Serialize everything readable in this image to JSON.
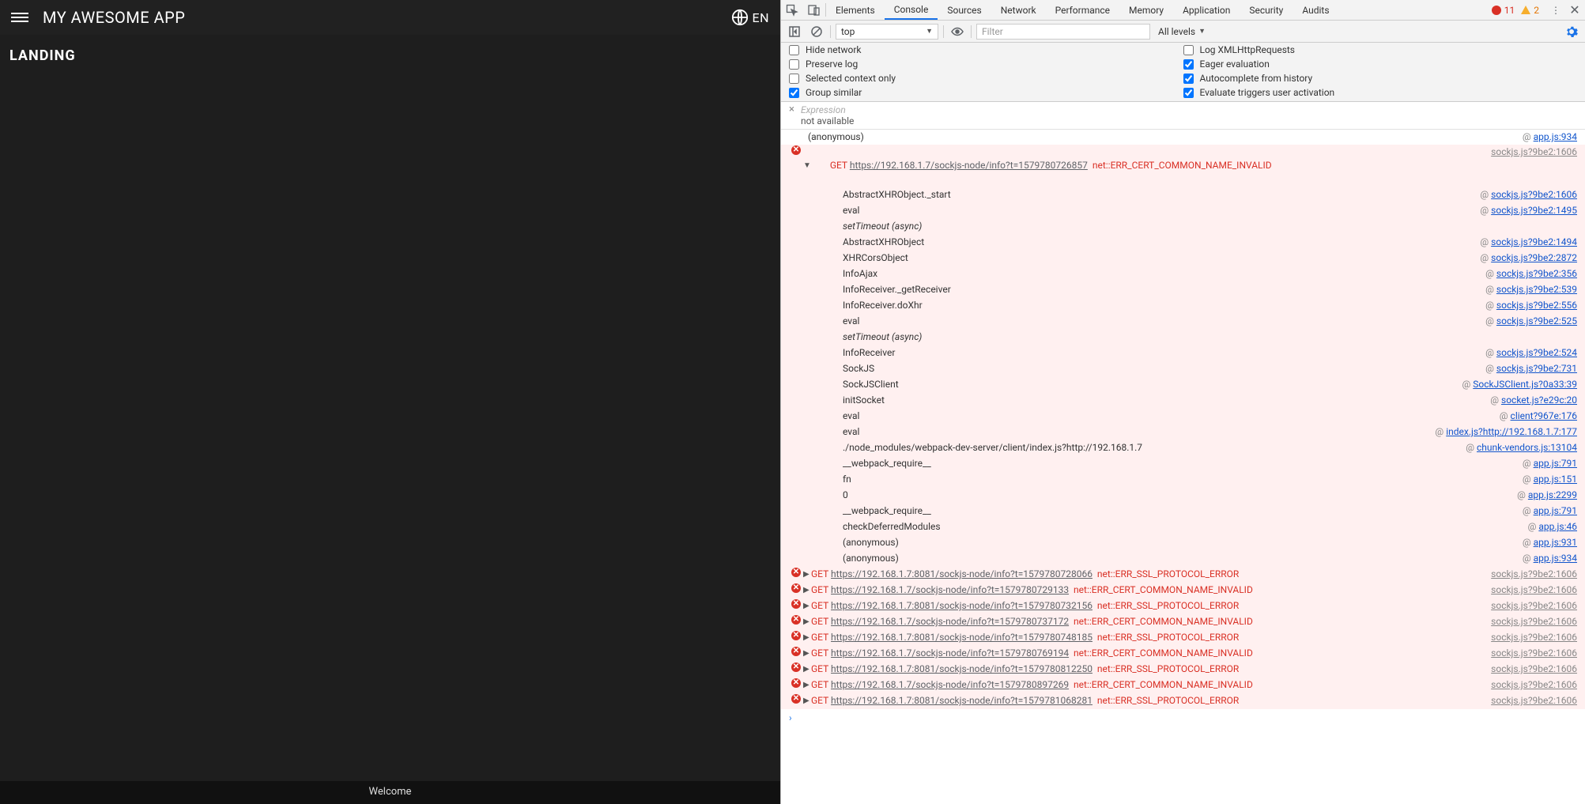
{
  "app": {
    "title": "MY AWESOME APP",
    "lang": "EN",
    "heading": "LANDING",
    "footer": "Welcome"
  },
  "devtools": {
    "tabs": [
      "Elements",
      "Console",
      "Sources",
      "Network",
      "Performance",
      "Memory",
      "Application",
      "Security",
      "Audits"
    ],
    "active_tab_index": 1,
    "error_count": "11",
    "warning_count": "2",
    "toolbar": {
      "context": "top",
      "filter_placeholder": "Filter",
      "levels_label": "All levels"
    },
    "options": [
      {
        "label": "Hide network",
        "checked": false
      },
      {
        "label": "Log XMLHttpRequests",
        "checked": false
      },
      {
        "label": "Preserve log",
        "checked": false
      },
      {
        "label": "Eager evaluation",
        "checked": true
      },
      {
        "label": "Selected context only",
        "checked": false
      },
      {
        "label": "Autocomplete from history",
        "checked": true
      },
      {
        "label": "Group similar",
        "checked": true
      },
      {
        "label": "Evaluate triggers user activation",
        "checked": true
      }
    ],
    "expression": {
      "placeholder": "Expression",
      "result": "not available"
    },
    "top_anonymous": {
      "label": "(anonymous)",
      "src": "app.js:934"
    },
    "expanded_error": {
      "method": "GET",
      "url": "https://192.168.1.7/sockjs-node/info?t=1579780726857",
      "err": "net::ERR_CERT_COMMON_NAME_INVALID",
      "src": "sockjs.js?9be2:1606",
      "stack": [
        {
          "fn": "AbstractXHRObject._start",
          "src": "sockjs.js?9be2:1606"
        },
        {
          "fn": "eval",
          "src": "sockjs.js?9be2:1495"
        },
        {
          "fn": "setTimeout (async)",
          "italic": true
        },
        {
          "fn": "AbstractXHRObject",
          "src": "sockjs.js?9be2:1494"
        },
        {
          "fn": "XHRCorsObject",
          "src": "sockjs.js?9be2:2872"
        },
        {
          "fn": "InfoAjax",
          "src": "sockjs.js?9be2:356"
        },
        {
          "fn": "InfoReceiver._getReceiver",
          "src": "sockjs.js?9be2:539"
        },
        {
          "fn": "InfoReceiver.doXhr",
          "src": "sockjs.js?9be2:556"
        },
        {
          "fn": "eval",
          "src": "sockjs.js?9be2:525"
        },
        {
          "fn": "setTimeout (async)",
          "italic": true
        },
        {
          "fn": "InfoReceiver",
          "src": "sockjs.js?9be2:524"
        },
        {
          "fn": "SockJS",
          "src": "sockjs.js?9be2:731"
        },
        {
          "fn": "SockJSClient",
          "src": "SockJSClient.js?0a33:39"
        },
        {
          "fn": "initSocket",
          "src": "socket.js?e29c:20"
        },
        {
          "fn": "eval",
          "src": "client?967e:176"
        },
        {
          "fn": "eval",
          "src": "index.js?http://192.168.1.7:177"
        },
        {
          "fn": "./node_modules/webpack-dev-server/client/index.js?http://192.168.1.7",
          "src": "chunk-vendors.js:13104"
        },
        {
          "fn": "__webpack_require__",
          "src": "app.js:791"
        },
        {
          "fn": "fn",
          "src": "app.js:151"
        },
        {
          "fn": "0",
          "src": "app.js:2299"
        },
        {
          "fn": "__webpack_require__",
          "src": "app.js:791"
        },
        {
          "fn": "checkDeferredModules",
          "src": "app.js:46"
        },
        {
          "fn": "(anonymous)",
          "src": "app.js:931"
        },
        {
          "fn": "(anonymous)",
          "src": "app.js:934"
        }
      ]
    },
    "collapsed_errors": [
      {
        "url": "https://192.168.1.7:8081/sockjs-node/info?t=1579780728066",
        "err": "net::ERR_SSL_PROTOCOL_ERROR",
        "src": "sockjs.js?9be2:1606"
      },
      {
        "url": "https://192.168.1.7/sockjs-node/info?t=1579780729133",
        "err": "net::ERR_CERT_COMMON_NAME_INVALID",
        "src": "sockjs.js?9be2:1606"
      },
      {
        "url": "https://192.168.1.7:8081/sockjs-node/info?t=1579780732156",
        "err": "net::ERR_SSL_PROTOCOL_ERROR",
        "src": "sockjs.js?9be2:1606"
      },
      {
        "url": "https://192.168.1.7/sockjs-node/info?t=1579780737172",
        "err": "net::ERR_CERT_COMMON_NAME_INVALID",
        "src": "sockjs.js?9be2:1606"
      },
      {
        "url": "https://192.168.1.7:8081/sockjs-node/info?t=1579780748185",
        "err": "net::ERR_SSL_PROTOCOL_ERROR",
        "src": "sockjs.js?9be2:1606"
      },
      {
        "url": "https://192.168.1.7/sockjs-node/info?t=1579780769194",
        "err": "net::ERR_CERT_COMMON_NAME_INVALID",
        "src": "sockjs.js?9be2:1606"
      },
      {
        "url": "https://192.168.1.7:8081/sockjs-node/info?t=1579780812250",
        "err": "net::ERR_SSL_PROTOCOL_ERROR",
        "src": "sockjs.js?9be2:1606"
      },
      {
        "url": "https://192.168.1.7/sockjs-node/info?t=1579780897269",
        "err": "net::ERR_CERT_COMMON_NAME_INVALID",
        "src": "sockjs.js?9be2:1606"
      },
      {
        "url": "https://192.168.1.7:8081/sockjs-node/info?t=1579781068281",
        "err": "net::ERR_SSL_PROTOCOL_ERROR",
        "src": "sockjs.js?9be2:1606"
      }
    ],
    "get_label": "GET",
    "at_symbol": "@"
  }
}
